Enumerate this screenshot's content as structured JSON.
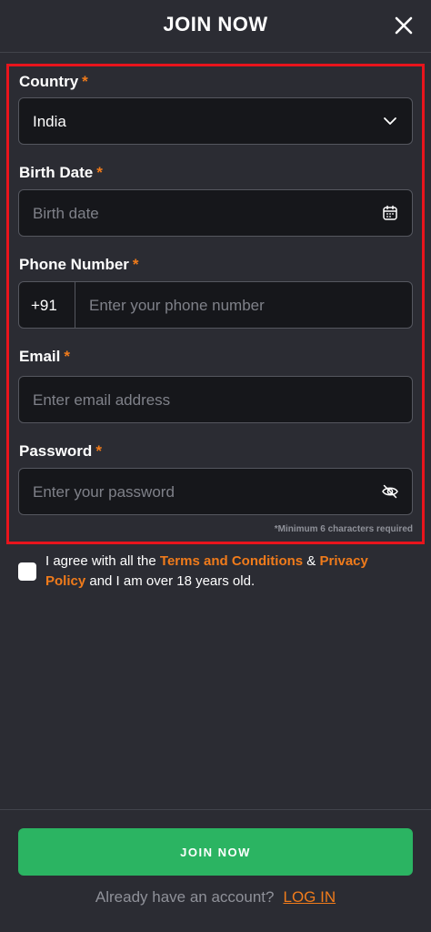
{
  "header": {
    "title": "JOIN NOW",
    "close_icon": "close-icon"
  },
  "form": {
    "required_marker": "*",
    "country": {
      "label": "Country",
      "value": "India",
      "icon": "chevron-down-icon"
    },
    "birth_date": {
      "label": "Birth Date",
      "placeholder": "Birth date",
      "icon": "calendar-icon"
    },
    "phone": {
      "label": "Phone Number",
      "prefix": "+91",
      "placeholder": "Enter your phone number"
    },
    "email": {
      "label": "Email",
      "placeholder": "Enter email address"
    },
    "password": {
      "label": "Password",
      "placeholder": "Enter your password",
      "icon": "eye-off-icon",
      "hint": "*Minimum 6 characters required"
    }
  },
  "agreement": {
    "checked": false,
    "text_before": "I agree with all the ",
    "terms_link": "Terms and Conditions",
    "and_text": " & ",
    "privacy_link": "Privacy Policy",
    "text_after": " and I am over 18 years old."
  },
  "footer": {
    "join_button": "JOIN NOW",
    "account_prompt": "Already have an account?",
    "login_link": "LOG IN"
  },
  "colors": {
    "accent": "#f07b1b",
    "button": "#2bb462",
    "highlight": "#e8141c",
    "background": "#2b2c33"
  }
}
